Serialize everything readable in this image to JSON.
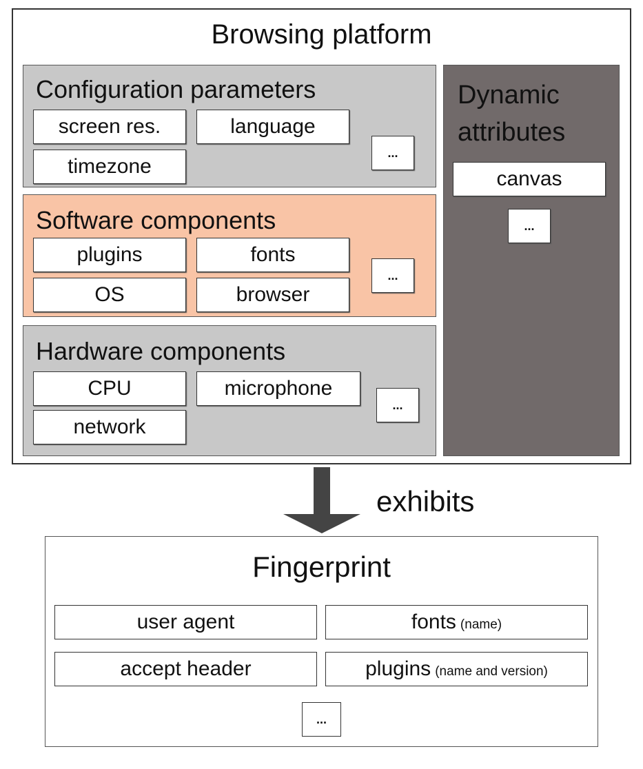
{
  "platform": {
    "title": "Browsing platform",
    "configuration": {
      "title": "Configuration parameters",
      "items": [
        "screen res.",
        "language",
        "timezone"
      ],
      "more": "..."
    },
    "software": {
      "title": "Software components",
      "items": [
        "plugins",
        "fonts",
        "OS",
        "browser"
      ],
      "more": "..."
    },
    "hardware": {
      "title": "Hardware components",
      "items": [
        "CPU",
        "microphone",
        "network"
      ],
      "more": "..."
    },
    "dynamic": {
      "title_line1": "Dynamic",
      "title_line2": "attributes",
      "items": [
        "canvas"
      ],
      "more": "..."
    }
  },
  "arrow": {
    "label": "exhibits"
  },
  "fingerprint": {
    "title": "Fingerprint",
    "items": [
      {
        "label": "user agent",
        "note": ""
      },
      {
        "label": "fonts",
        "note": "(name)"
      },
      {
        "label": "accept header",
        "note": ""
      },
      {
        "label": "plugins",
        "note": "(name and version)"
      }
    ],
    "more": "..."
  },
  "colors": {
    "gray_panel": "#c8c8c8",
    "software_panel": "#f9c4a6",
    "dynamic_panel": "#716a6a",
    "arrow": "#444444"
  }
}
